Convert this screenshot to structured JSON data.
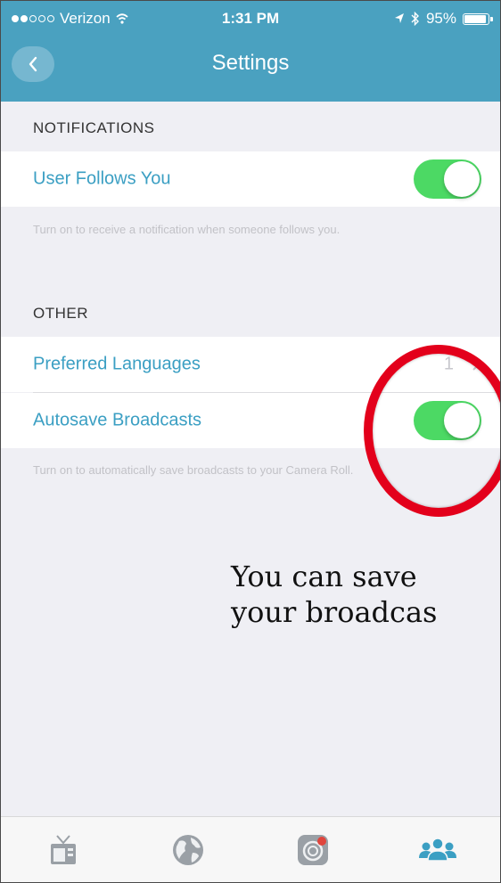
{
  "status_bar": {
    "carrier": "Verizon",
    "time": "1:31 PM",
    "battery": "95%"
  },
  "header": {
    "title": "Settings",
    "back_icon": "chevron-left-icon"
  },
  "sections": {
    "notifications": {
      "label": "NOTIFICATIONS",
      "user_follows": {
        "label": "User Follows You",
        "enabled": true
      },
      "footnote": "Turn on to receive a notification when someone follows you."
    },
    "other": {
      "label": "OTHER",
      "preferred_languages": {
        "label": "Preferred Languages",
        "value": "1"
      },
      "autosave": {
        "label": "Autosave Broadcasts",
        "enabled": true
      },
      "footnote": "Turn on to automatically save broadcasts to your Camera Roll."
    }
  },
  "annotation": {
    "line1": "You can save",
    "line2": "your broadcas"
  },
  "tabs": [
    {
      "name": "tv-icon"
    },
    {
      "name": "globe-icon"
    },
    {
      "name": "camera-icon"
    },
    {
      "name": "people-icon"
    }
  ],
  "colors": {
    "header": "#4aa1c0",
    "accent": "#3b9fc3",
    "toggle_on": "#4cd964",
    "ring": "#e3001b"
  }
}
